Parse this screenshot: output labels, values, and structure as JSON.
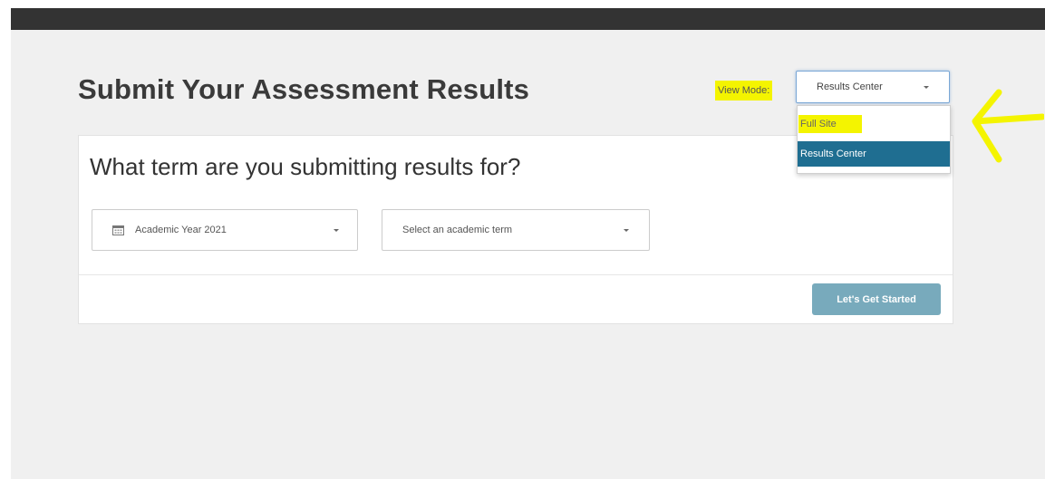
{
  "header": {
    "title": "Submit Your Assessment Results"
  },
  "view_mode": {
    "label": "View Mode:",
    "selected": "Results Center",
    "options": [
      {
        "label": "Full Site",
        "highlighted": false
      },
      {
        "label": "Results Center",
        "highlighted": true
      }
    ]
  },
  "card": {
    "heading": "What term are you submitting results for?",
    "year_select": {
      "value": "Academic Year 2021",
      "icon": "calendar-icon"
    },
    "term_select": {
      "placeholder": "Select an academic term"
    },
    "start_button_label": "Let's Get Started"
  },
  "colors": {
    "top_bar": "#333333",
    "page_background": "#f0f0f0",
    "annotation_highlight": "#f4f400",
    "selected_option": "#1f6e91",
    "start_button": "#78aabc"
  }
}
